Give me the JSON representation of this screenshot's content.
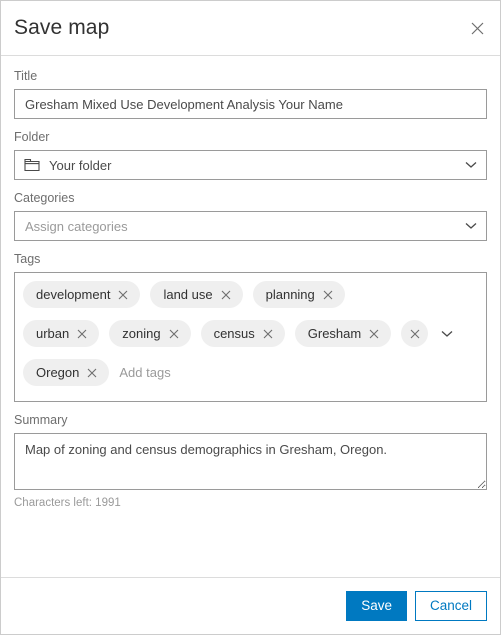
{
  "dialog": {
    "title": "Save map",
    "close_icon": "close-icon"
  },
  "title_field": {
    "label": "Title",
    "value": "Gresham Mixed Use Development Analysis Your Name",
    "placeholder": "Title"
  },
  "folder_field": {
    "label": "Folder",
    "value": "Your folder",
    "icon": "folder-icon",
    "chevron": "chevron-down-icon"
  },
  "categories_field": {
    "label": "Categories",
    "value": "",
    "placeholder": "Assign categories",
    "chevron": "chevron-down-icon"
  },
  "tags_field": {
    "label": "Tags",
    "placeholder": "Add tags",
    "value": "",
    "clear_all_icon": "close-icon",
    "chevron": "chevron-down-icon",
    "rows": [
      [
        {
          "label": "development"
        },
        {
          "label": "land use"
        },
        {
          "label": "planning"
        }
      ],
      [
        {
          "label": "urban"
        },
        {
          "label": "zoning"
        },
        {
          "label": "census"
        },
        {
          "label": "Gresham"
        }
      ],
      [
        {
          "label": "Oregon"
        }
      ]
    ],
    "tags": [
      "development",
      "land use",
      "planning",
      "urban",
      "zoning",
      "census",
      "Gresham",
      "Oregon"
    ]
  },
  "summary_field": {
    "label": "Summary",
    "value": "Map of zoning and census demographics in Gresham, Oregon.",
    "placeholder": "Summary",
    "characters_left": "Characters left: 1991"
  },
  "footer": {
    "save_label": "Save",
    "cancel_label": "Cancel"
  },
  "colors": {
    "accent": "#0079c1",
    "border": "#9a9a9a",
    "divider": "#dcdcdc",
    "pill_bg": "#efefef",
    "label_text": "#6e6e6e",
    "value_text": "#4a4a4a",
    "placeholder_text": "#9a9a9a"
  }
}
